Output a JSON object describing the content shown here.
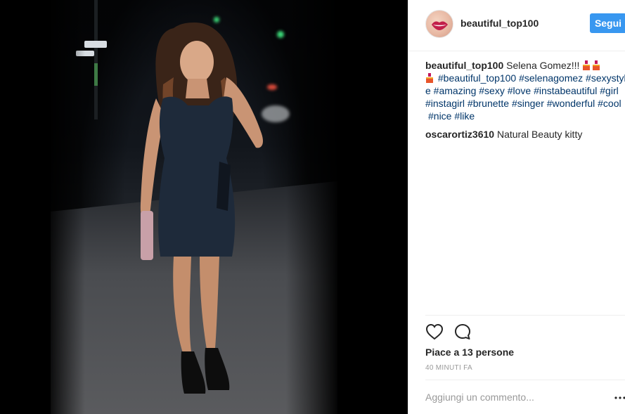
{
  "post": {
    "username": "beautiful_top100",
    "follow_label": "Segui",
    "caption": {
      "user": "beautiful_top100",
      "line1_text": " Selena Gomez!!! ",
      "line2_tags": "#beautiful_top100 #selenagomez #sexystyl",
      "line3_tags": "e #amazing #sexy #love #instabeautiful #girl",
      "line4_tags": "#instagirl #brunette #singer #wonderful #cool",
      "line5_tags": "#nice #like"
    },
    "comments": [
      {
        "user": "oscarortiz3610",
        "text": " Natural Beauty kitty"
      }
    ],
    "likes_text": "Piace a 13 persone",
    "timestamp": "40 MINUTI FA",
    "comment_placeholder": "Aggiungi un commento..."
  },
  "icons": {
    "avatar": "avatar-lips",
    "like": "heart-icon",
    "comment": "comment-bubble-icon",
    "more": "more-options-icon",
    "caption_emoji": "nail-polish-icon"
  },
  "colors": {
    "accent": "#3897f0",
    "hashtag": "#003569",
    "muted": "#999999",
    "text": "#262626"
  }
}
